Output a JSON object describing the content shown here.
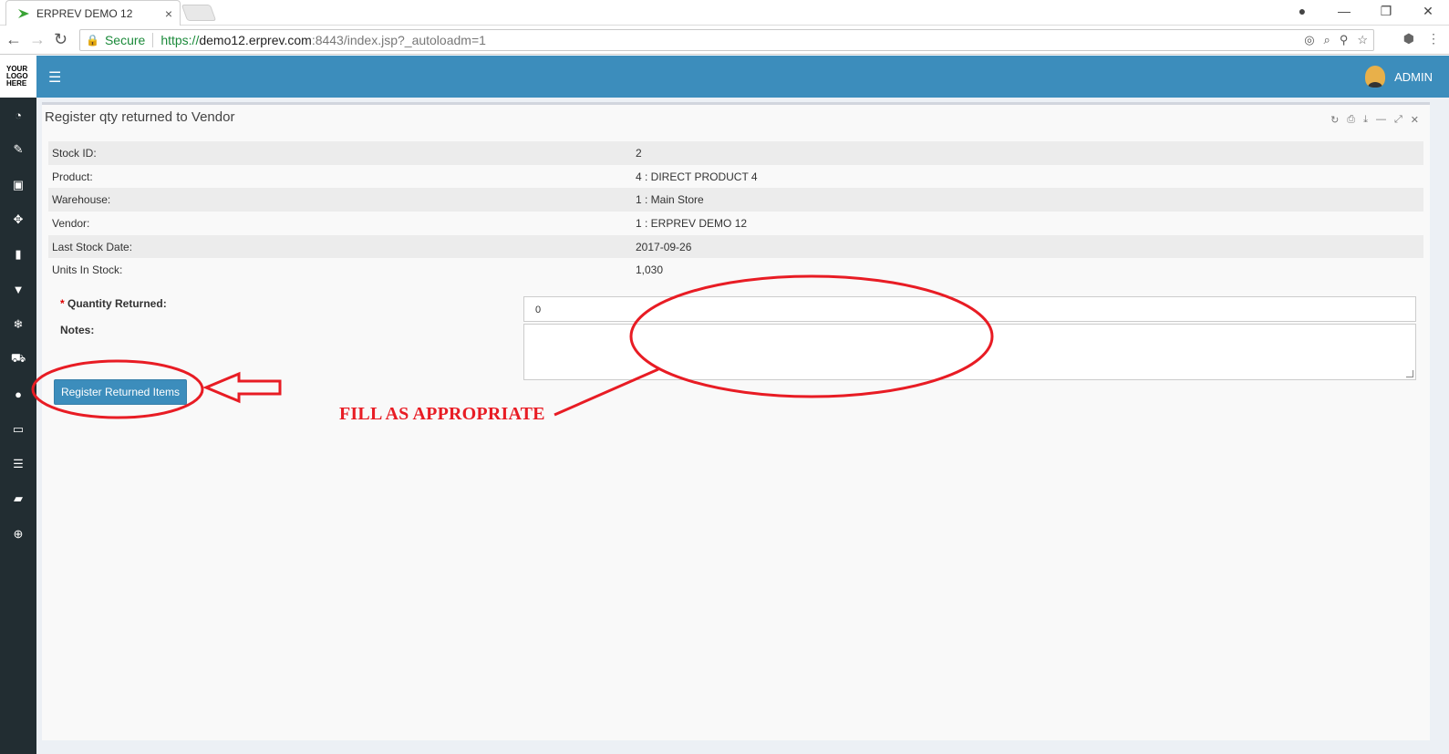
{
  "browser": {
    "tab_title": "ERPREV DEMO 12",
    "tab_close": "×",
    "secure_label": "Secure",
    "url_scheme": "https://",
    "url_host": "demo12.erprev.com",
    "url_rest": ":8443/index.jsp?_autoloadm=1"
  },
  "sidebar": {
    "logo_text": "YOUR LOGO HERE"
  },
  "topbar": {
    "user_label": "ADMIN"
  },
  "box": {
    "title": "Register qty returned to Vendor"
  },
  "details": [
    {
      "label": "Stock ID:",
      "value": "2"
    },
    {
      "label": "Product:",
      "value": "4 : DIRECT PRODUCT 4"
    },
    {
      "label": "Warehouse:",
      "value": "1 : Main Store"
    },
    {
      "label": "Vendor:",
      "value": "1 : ERPREV DEMO 12"
    },
    {
      "label": "Last Stock Date:",
      "value": "2017-09-26"
    },
    {
      "label": "Units In Stock:",
      "value": "1,030"
    }
  ],
  "form": {
    "required_mark": "*",
    "quantity_label": "Quantity Returned:",
    "quantity_value": "0",
    "notes_label": "Notes:",
    "submit_label": "Register Returned Items"
  },
  "annotation": {
    "text": "FILL AS APPROPRIATE",
    "color": "#e81c24"
  }
}
